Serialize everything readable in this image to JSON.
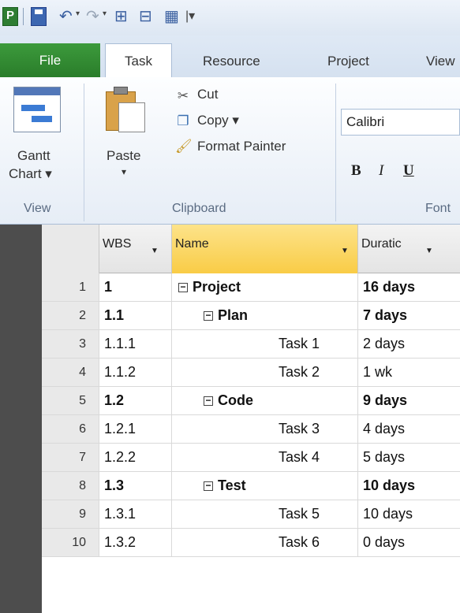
{
  "qat": {
    "logo_letter": "P",
    "customize_glyph": "|▾"
  },
  "tabs": [
    {
      "label": "File"
    },
    {
      "label": "Task"
    },
    {
      "label": "Resource"
    },
    {
      "label": "Project"
    },
    {
      "label": "View"
    }
  ],
  "ribbon": {
    "gantt": {
      "line1": "Gantt",
      "line2": "Chart ▾",
      "group": "View"
    },
    "clipboard": {
      "paste": "Paste",
      "paste_arrow": "▾",
      "cut": "Cut",
      "copy": "Copy ▾",
      "format_painter": "Format Painter",
      "group": "Clipboard"
    },
    "font": {
      "name": "Calibri",
      "bold": "B",
      "italic": "I",
      "underline": "U",
      "group": "Font"
    }
  },
  "grid": {
    "columns": {
      "wbs": "WBS",
      "name": "Name",
      "duration": "Duratic"
    },
    "rows": [
      {
        "n": "1",
        "wbs": "1",
        "name": "Project",
        "duration": "16 days",
        "summary": true,
        "level": 0
      },
      {
        "n": "2",
        "wbs": "1.1",
        "name": "Plan",
        "duration": "7 days",
        "summary": true,
        "level": 1
      },
      {
        "n": "3",
        "wbs": "1.1.1",
        "name": "Task 1",
        "duration": "2 days",
        "summary": false,
        "level": 2
      },
      {
        "n": "4",
        "wbs": "1.1.2",
        "name": "Task 2",
        "duration": "1 wk",
        "summary": false,
        "level": 2
      },
      {
        "n": "5",
        "wbs": "1.2",
        "name": "Code",
        "duration": "9 days",
        "summary": true,
        "level": 1
      },
      {
        "n": "6",
        "wbs": "1.2.1",
        "name": "Task 3",
        "duration": "4 days",
        "summary": false,
        "level": 2
      },
      {
        "n": "7",
        "wbs": "1.2.2",
        "name": "Task 4",
        "duration": "5 days",
        "summary": false,
        "level": 2
      },
      {
        "n": "8",
        "wbs": "1.3",
        "name": "Test",
        "duration": "10 days",
        "summary": true,
        "level": 1
      },
      {
        "n": "9",
        "wbs": "1.3.1",
        "name": "Task 5",
        "duration": "10 days",
        "summary": false,
        "level": 2
      },
      {
        "n": "10",
        "wbs": "1.3.2",
        "name": "Task 6",
        "duration": "0 days",
        "summary": false,
        "level": 2
      }
    ]
  },
  "colors": {
    "file_tab": "#2e8b2e",
    "name_header": "#f9cc46",
    "row_header": "#e9e9e9",
    "dark_strip": "#4d4d4d"
  }
}
